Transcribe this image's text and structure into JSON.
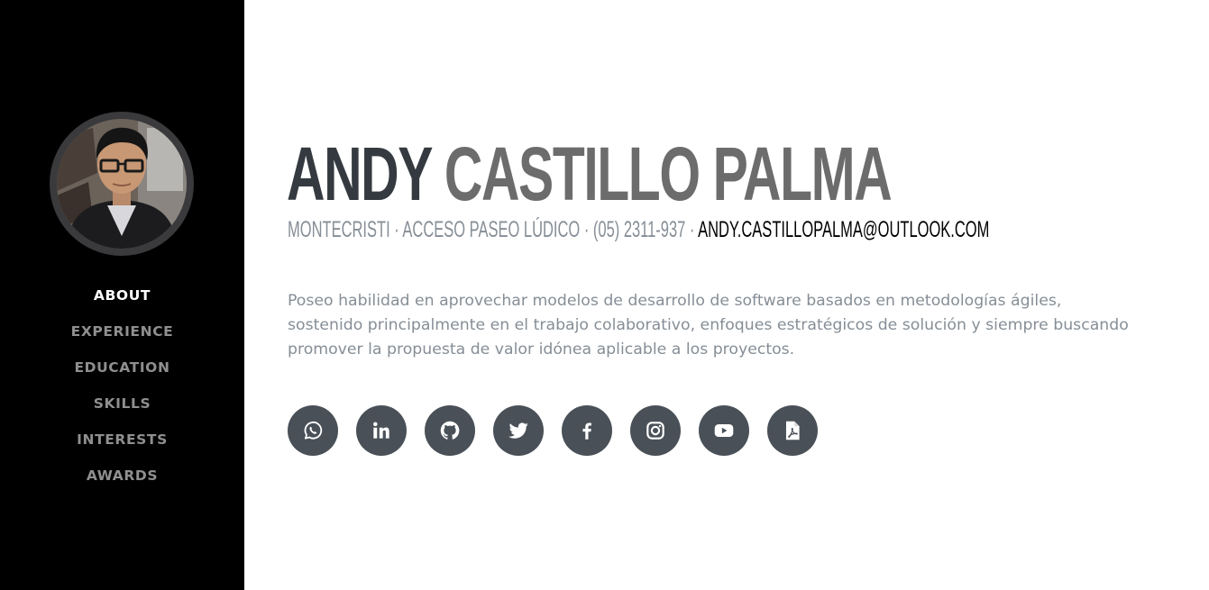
{
  "sidebar": {
    "nav": [
      {
        "label": "ABOUT",
        "active": true
      },
      {
        "label": "EXPERIENCE",
        "active": false
      },
      {
        "label": "EDUCATION",
        "active": false
      },
      {
        "label": "SKILLS",
        "active": false
      },
      {
        "label": "INTERESTS",
        "active": false
      },
      {
        "label": "AWARDS",
        "active": false
      }
    ]
  },
  "header": {
    "first_name": "ANDY",
    "last_name": "CASTILLO PALMA",
    "contact_info": "MONTECRISTI · ACCESO PASEO LÚDICO · (05) 2311-937 · ",
    "email": "ANDY.CASTILLOPALMA@OUTLOOK.COM"
  },
  "about": {
    "text": "Poseo habilidad en aprovechar modelos de desarrollo de software basados en metodologías ágiles, sostenido principalmente en el trabajo colaborativo, enfoques estratégicos de solución y siempre buscando promover la propuesta de valor idónea aplicable a los proyectos."
  },
  "social": [
    {
      "icon": "whatsapp-icon"
    },
    {
      "icon": "linkedin-icon"
    },
    {
      "icon": "github-icon"
    },
    {
      "icon": "twitter-icon"
    },
    {
      "icon": "facebook-icon"
    },
    {
      "icon": "instagram-icon"
    },
    {
      "icon": "youtube-icon"
    },
    {
      "icon": "pdf-file-icon"
    }
  ],
  "colors": {
    "sidebar_bg": "#000000",
    "nav_active": "#ffffff",
    "nav_inactive": "#8f8f8f",
    "name_dark": "#343a40",
    "name_gray": "#6c6c6c",
    "muted_text": "#868e96",
    "social_bg": "#495057"
  }
}
